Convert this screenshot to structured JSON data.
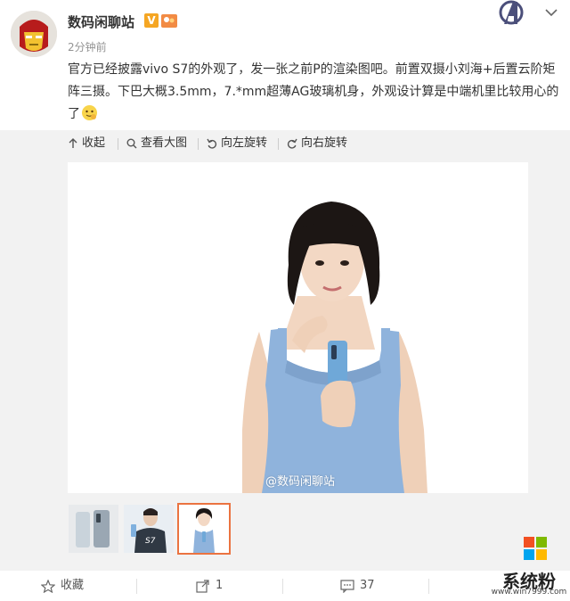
{
  "post": {
    "author": "数码闲聊站",
    "verified_badge": "V",
    "timestamp": "2分钟前",
    "text": "官方已经披露vivo S7的外观了，发一张之前P的渲染图吧。前置双摄小刘海+后置云阶矩阵三摄。下巴大概3.5mm，7.*mm超薄AG玻璃机身，外观设计算是中端机里比较用心的了",
    "emoji_icon": "face-emoji-icon"
  },
  "toolbar": {
    "collapse": "收起",
    "view_large": "查看大图",
    "rotate_left": "向左旋转",
    "rotate_right": "向右旋转"
  },
  "image": {
    "watermark": "@数码闲聊站"
  },
  "thumbnails": {
    "phone_label": "S7",
    "selected_index": 3,
    "count": 3
  },
  "footer": {
    "favorite": "收藏",
    "repost_count": "1",
    "comment_count": "37"
  },
  "site": {
    "name": "系统粉",
    "url": "www.win7999.com"
  },
  "colors": {
    "accent": "#eb7340",
    "verified": "#f5a623",
    "background_gray": "#f2f2f2",
    "dress_blue": "#8fb3dc",
    "phone_blue": "#6fa8d8"
  }
}
